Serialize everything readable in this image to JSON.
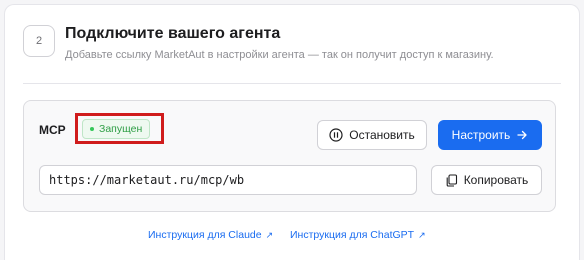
{
  "step": {
    "number": "2"
  },
  "header": {
    "title": "Подключите вашего агента",
    "subtitle": "Добавьте ссылку MarketAut в настройки агента — так он получит доступ к магазину."
  },
  "mcp": {
    "label": "MCP",
    "status": "Запущен",
    "status_color": "#34c759",
    "url": "https://marketaut.ru/mcp/wb"
  },
  "buttons": {
    "stop": "Остановить",
    "configure": "Настроить",
    "copy": "Копировать"
  },
  "links": {
    "claude": "Инструкция для Claude",
    "chatgpt": "Инструкция для ChatGPT"
  },
  "colors": {
    "accent": "#1a6cf0",
    "highlight": "#d01c1c"
  }
}
